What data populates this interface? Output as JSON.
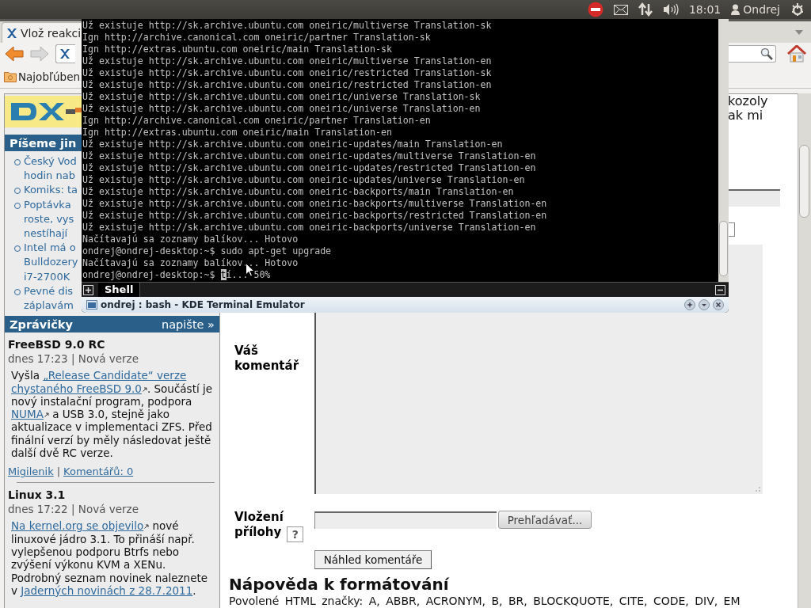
{
  "top_panel": {
    "time": "18:01",
    "user": "Ondrej"
  },
  "browser": {
    "tab_title": "Vlož reakci",
    "bookmark": "Najobľúben",
    "sidebar": {
      "links_title": "Píšeme jin",
      "links": [
        {
          "lines": [
            "Český Vod",
            "hodin nab"
          ]
        },
        {
          "lines": [
            "Komiks: ta"
          ]
        },
        {
          "lines": [
            "Poptávka",
            "roste, vys",
            "nestíhají"
          ]
        },
        {
          "lines": [
            "Intel má o",
            "Bulldozery",
            "i7-2700K"
          ]
        },
        {
          "lines": [
            "Pevné dis",
            "záplavám"
          ]
        }
      ],
      "news_title": "Zprávičky",
      "news_action": "napište »",
      "news": [
        {
          "title": "FreeBSD 9.0 RC",
          "meta": "dnes 17:23 | Nová verze",
          "body": [
            {
              "kind": "text",
              "text": "Vyšla "
            },
            {
              "kind": "link",
              "text": "„Release Candidate“ verze",
              "external": false
            },
            {
              "kind": "link",
              "text": "chystaného FreeBSD 9.0",
              "external": true
            },
            {
              "kind": "text",
              "text": ". Součástí je nový instalační program, podpora "
            },
            {
              "kind": "link",
              "text": "NUMA",
              "external": true
            },
            {
              "kind": "text",
              "text": " a USB 3.0, stejně jako aktualizace v implementaci ZFS. Před finální verzí by měly následovat ještě další dvě RC verze."
            }
          ],
          "author": "Migilenik",
          "separator": "|",
          "comments": "Komentářů: 0"
        },
        {
          "title": "Linux 3.1",
          "meta": "dnes 17:22 | Nová verze",
          "body": [
            {
              "kind": "link",
              "text": "Na kernel.org se objevilo",
              "external": true
            },
            {
              "kind": "text",
              "text": " nové linuxové jádro 3.1. To přináší např. vylepšenou podporu Btrfs nebo zvýšení výkonu KVM a XENu. Podrobný seznam novinek naleznete v "
            },
            {
              "kind": "link",
              "text": "Jaderných novinách z 28.7.2011",
              "external": false
            },
            {
              "kind": "text",
              "text": "."
            }
          ]
        }
      ]
    },
    "main": {
      "fragments": [
        "kozoly",
        "ak mi"
      ],
      "comment_label": "Váš komentář",
      "attach_label": "Vložení přílohy",
      "help_button": "?",
      "browse_button": "Prehľadávať...",
      "preview_button": "Náhled komentáře",
      "help_heading": "Nápověda k formátování",
      "help_text": "Povolené HTML značky: A, ABBR, ACRONYM, B, BR, BLOCKQUOTE, CITE, CODE, DIV, EM"
    }
  },
  "terminal": {
    "lines": [
      "Už existuje http://sk.archive.ubuntu.com oneiric/multiverse Translation-sk",
      "Ign http://archive.canonical.com oneiric/partner Translation-sk",
      "Ign http://extras.ubuntu.com oneiric/main Translation-sk",
      "Už existuje http://sk.archive.ubuntu.com oneiric/multiverse Translation-en",
      "Už existuje http://sk.archive.ubuntu.com oneiric/restricted Translation-sk",
      "Už existuje http://sk.archive.ubuntu.com oneiric/restricted Translation-en",
      "Už existuje http://sk.archive.ubuntu.com oneiric/universe Translation-sk",
      "Už existuje http://sk.archive.ubuntu.com oneiric/universe Translation-en",
      "Ign http://archive.canonical.com oneiric/partner Translation-en",
      "Ign http://extras.ubuntu.com oneiric/main Translation-en",
      "Už existuje http://sk.archive.ubuntu.com oneiric-updates/main Translation-en",
      "Už existuje http://sk.archive.ubuntu.com oneiric-updates/multiverse Translation-en",
      "Už existuje http://sk.archive.ubuntu.com oneiric-updates/restricted Translation-en",
      "Už existuje http://sk.archive.ubuntu.com oneiric-updates/universe Translation-en",
      "Už existuje http://sk.archive.ubuntu.com oneiric-backports/main Translation-en",
      "Už existuje http://sk.archive.ubuntu.com oneiric-backports/multiverse Translation-en",
      "Už existuje http://sk.archive.ubuntu.com oneiric-backports/restricted Translation-en",
      "Už existuje http://sk.archive.ubuntu.com oneiric-backports/universe Translation-en",
      "Načítavajú sa zoznamy balíkov... Hotovo",
      "ondrej@ondrej-desktop:~$ sudo apt-get upgrade",
      "Načítavajú sa zoznamy balíkov... Hotovo"
    ],
    "input": {
      "prompt": "ondrej@ondrej-desktop:~$ ",
      "cursor": "t",
      "after": "í... 50%"
    },
    "tab": "Shell",
    "title": "ondrej : bash - KDE Terminal Emulator"
  }
}
